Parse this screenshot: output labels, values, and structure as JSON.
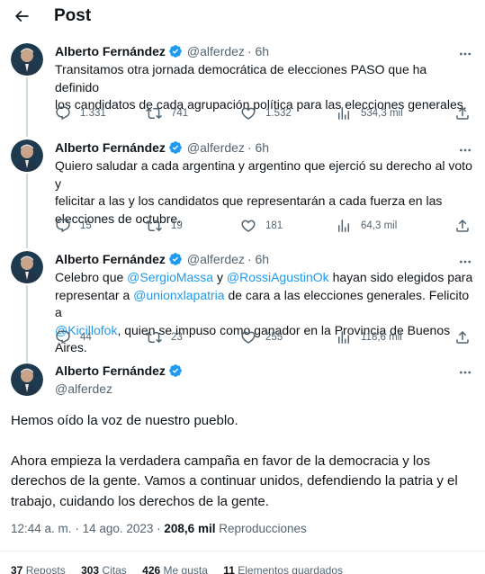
{
  "header": {
    "title": "Post"
  },
  "author": {
    "name": "Alberto Fernández",
    "handle": "@alferdez",
    "time": "· 6h"
  },
  "tweets": [
    {
      "segments": [
        "Transitamos otra jornada democrática de elecciones PASO que ha definido",
        "los candidatos de cada agrupación política para las elecciones generales."
      ],
      "replies": "1.331",
      "reposts": "741",
      "likes": "1.532",
      "views": "534,3 mil"
    },
    {
      "segments": [
        "Quiero saludar a cada argentina y argentino que ejerció su derecho al voto y",
        "felicitar a las y los candidatos que representarán a cada fuerza en las",
        "elecciones de octubre."
      ],
      "replies": "15",
      "reposts": "19",
      "likes": "181",
      "views": "64,3 mil"
    },
    {
      "segments": [
        "Celebro que ",
        "@SergioMassa",
        " y ",
        "@RossiAgustinOk",
        " hayan sido elegidos para",
        "representar a ",
        "@unionxlapatria",
        " de cara a las elecciones generales. Felicito a",
        "@Kicillofok",
        ", quien se impuso como ganador en la Provincia de Buenos Aires."
      ],
      "replies": "44",
      "reposts": "23",
      "likes": "255",
      "views": "118,6 mil"
    }
  ],
  "main_tweet": {
    "paragraph1": "Hemos oído la voz de nuestro pueblo.",
    "paragraph2_lines": [
      "Ahora empieza la verdadera campaña en favor de la democracia y los",
      "derechos de la gente. Vamos a continuar unidos, defendiendo la patria y el",
      "trabajo, cuidando los derechos de la gente."
    ],
    "time": "12:44 a. m.",
    "date": "14 ago. 2023",
    "views_count": "208,6 mil",
    "views_label": "Reproducciones"
  },
  "stats": [
    {
      "count": "37",
      "label": "Reposts"
    },
    {
      "count": "303",
      "label": "Citas"
    },
    {
      "count": "426",
      "label": "Me gusta"
    },
    {
      "count": "11",
      "label": "Elementos guardados"
    }
  ],
  "colors": {
    "link": "#1d9bf0",
    "verified": "#1d9bf0",
    "muted": "#536471",
    "text": "#0f1419"
  }
}
